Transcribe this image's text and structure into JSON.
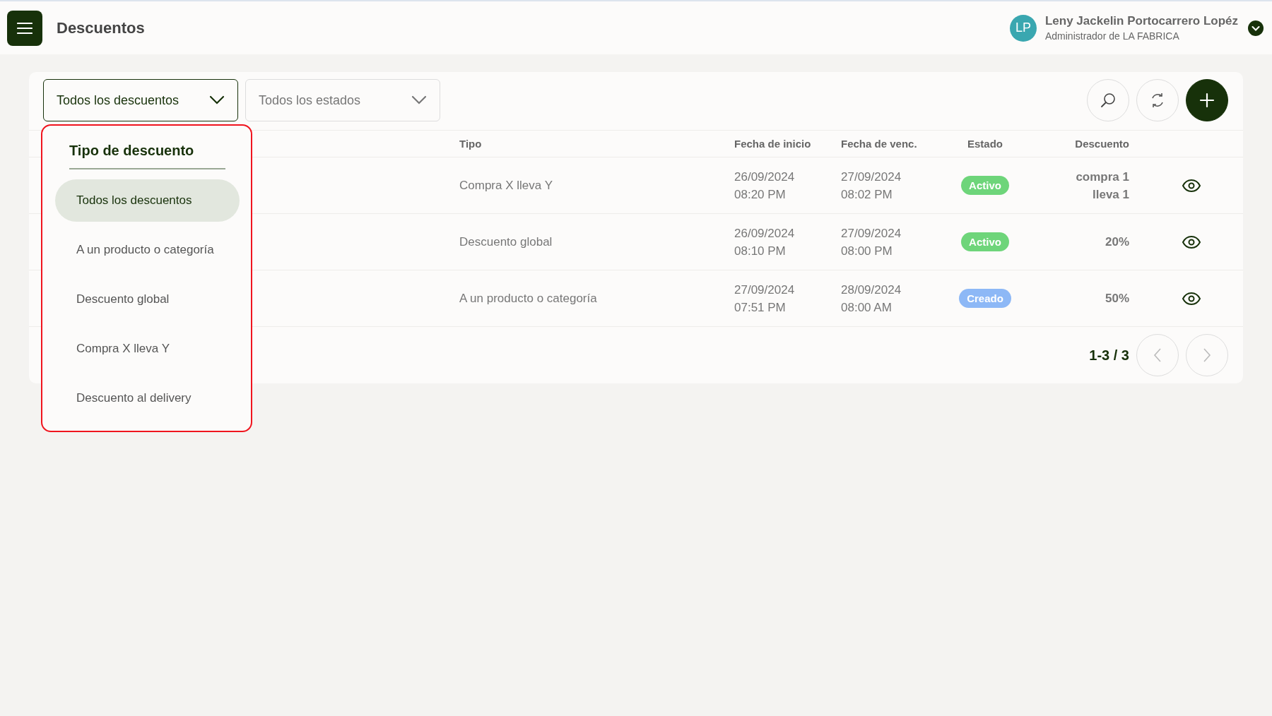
{
  "header": {
    "title": "Descuentos",
    "user": {
      "initials": "LP",
      "name": "Leny Jackelin Portocarrero Lopéz",
      "role": "Administrador de LA FABRICA"
    }
  },
  "filters": [
    {
      "value": "Todos los descuentos",
      "active": true
    },
    {
      "value": "Todos los estados",
      "active": false
    }
  ],
  "dropdown": {
    "title": "Tipo de descuento",
    "options": [
      {
        "label": "Todos los descuentos",
        "selected": true
      },
      {
        "label": "A un producto o categoría",
        "selected": false
      },
      {
        "label": "Descuento global",
        "selected": false
      },
      {
        "label": "Compra X lleva Y",
        "selected": false
      },
      {
        "label": "Descuento al delivery",
        "selected": false
      }
    ]
  },
  "table": {
    "columns": [
      "Tipo",
      "Fecha de inicio",
      "Fecha de venc.",
      "Estado",
      "Descuento"
    ],
    "rows": [
      {
        "tipo": "Compra X lleva Y",
        "start": [
          "26/09/2024",
          "08:20 PM"
        ],
        "end": [
          "27/09/2024",
          "08:02 PM"
        ],
        "status": {
          "label": "Activo",
          "color": "#6ed57a"
        },
        "discount": [
          "compra 1",
          "lleva 1"
        ]
      },
      {
        "tipo": "Descuento global",
        "start": [
          "26/09/2024",
          "08:10 PM"
        ],
        "end": [
          "27/09/2024",
          "08:00 PM"
        ],
        "status": {
          "label": "Activo",
          "color": "#6ed57a"
        },
        "discount": [
          "20%"
        ]
      },
      {
        "tipo": "A un producto o categoría",
        "start": [
          "27/09/2024",
          "07:51 PM"
        ],
        "end": [
          "28/09/2024",
          "08:00 AM"
        ],
        "status": {
          "label": "Creado",
          "color": "#8db8f6"
        },
        "discount": [
          "50%"
        ]
      }
    ]
  },
  "pagination": {
    "range": "1-3 / 3"
  }
}
